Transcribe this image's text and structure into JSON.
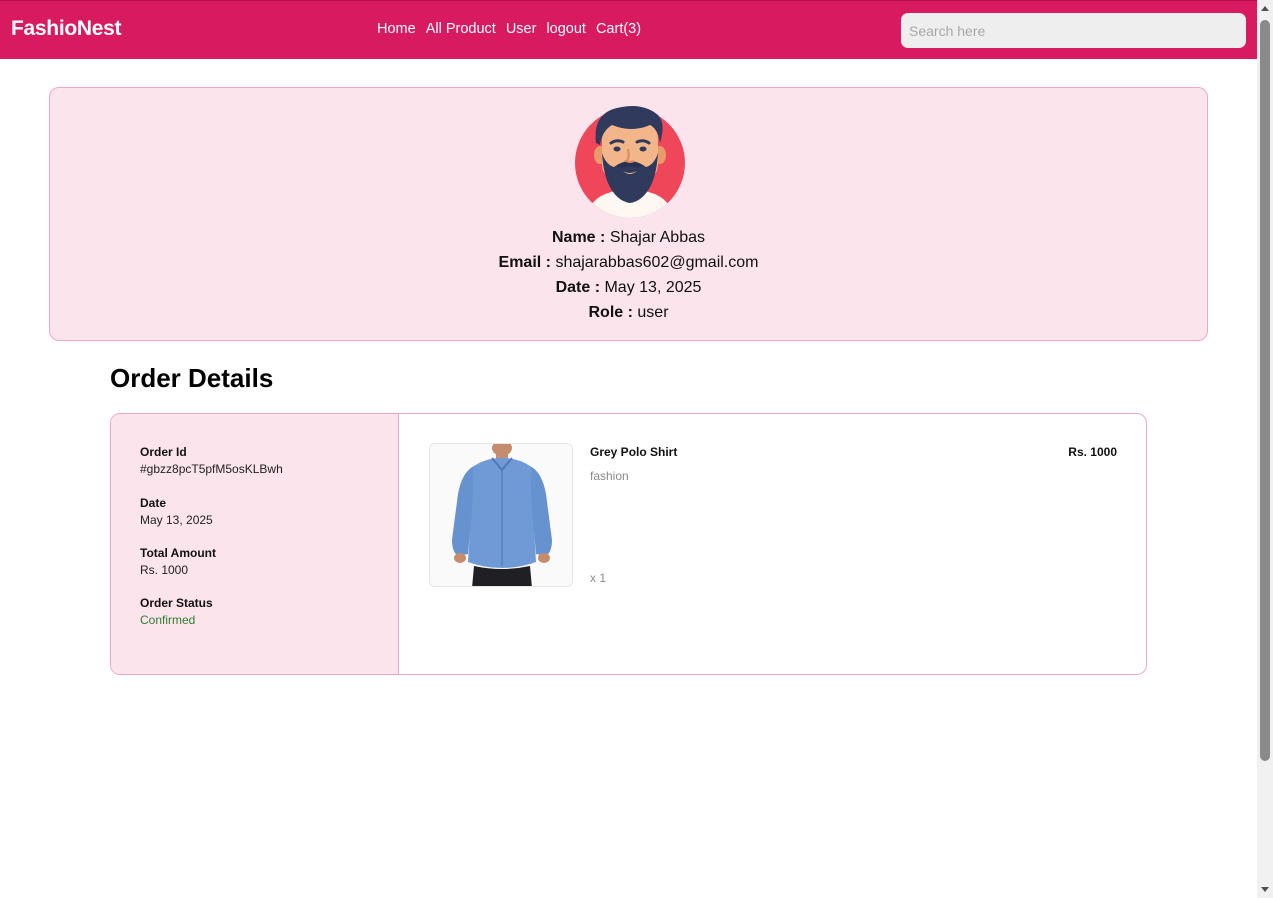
{
  "brand": "FashioNest",
  "nav": {
    "links": [
      "Home",
      "All Product",
      "User",
      "logout",
      "Cart(3)"
    ]
  },
  "search": {
    "placeholder": "Search here",
    "value": ""
  },
  "profile": {
    "avatar_icon": "bearded-man-avatar-icon",
    "name_label": "Name :",
    "name": "Shajar Abbas",
    "email_label": "Email :",
    "email": "shajarabbas602@gmail.com",
    "date_label": "Date :",
    "date": "May 13, 2025",
    "role_label": "Role :",
    "role": "user"
  },
  "orders": {
    "title": "Order Details",
    "items": [
      {
        "id_label": "Order Id",
        "id": "#gbzz8pcT5pfM5osKLBwh",
        "date_label": "Date",
        "date": "May 13, 2025",
        "total_label": "Total Amount",
        "total": "Rs. 1000",
        "status_label": "Order Status",
        "status": "Confirmed",
        "product": {
          "name": "Grey Polo Shirt",
          "category": "fashion",
          "price": "Rs. 1000",
          "quantity": "x 1"
        }
      }
    ]
  },
  "colors": {
    "primary": "#d81b60",
    "card_bg": "#fbe4ec",
    "card_border": "#f2a7c2",
    "status_confirmed": "#2e7d32"
  }
}
